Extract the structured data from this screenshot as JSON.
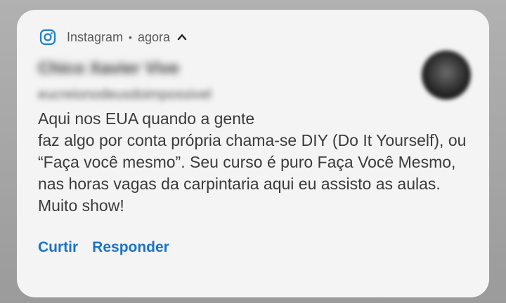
{
  "notification": {
    "app_name": "Instagram",
    "separator": "•",
    "time": "agora",
    "sender_name": "Chico Xavier Vive",
    "sender_subtitle": "eucreionodeusdoimpossivel",
    "message": "Aqui nos EUA quando a gente\nfaz algo por conta própria chama-se DIY (Do It Yourself), ou “Faça você mesmo”. Seu curso é puro Faça Você Mesmo, nas horas vagas da carpintaria aqui eu assisto as aulas. Muito show!",
    "actions": [
      {
        "label": "Curtir"
      },
      {
        "label": "Responder"
      }
    ],
    "app_icon": "instagram-icon",
    "expand_icon": "chevron-up-icon",
    "accent_color": "#1a73c8"
  }
}
